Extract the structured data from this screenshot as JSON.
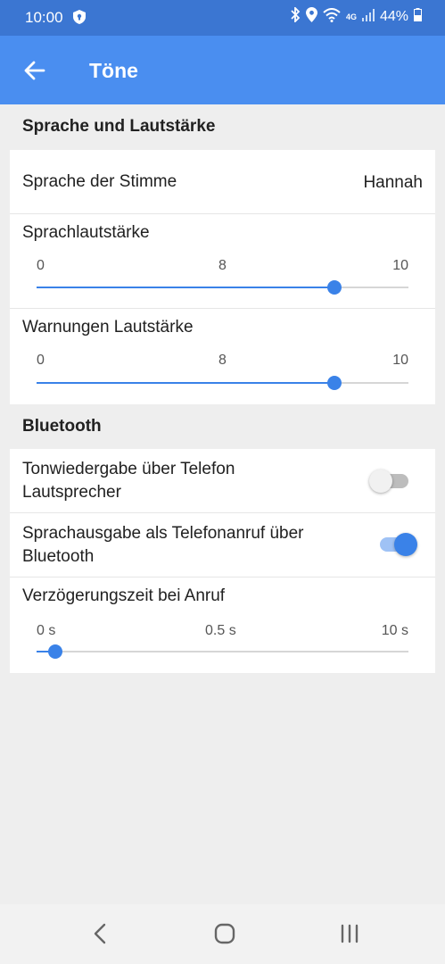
{
  "status": {
    "time": "10:00",
    "battery": "44%",
    "network": "4G",
    "icons": [
      "shield-icon",
      "bluetooth-icon",
      "location-icon",
      "wifi-icon",
      "signal-icon",
      "battery-icon"
    ]
  },
  "appbar": {
    "title": "Töne",
    "back_icon": "arrow-left-icon"
  },
  "colors": {
    "statusbar": "#3b76d2",
    "appbar": "#4a8ef0",
    "accent": "#3a82e8"
  },
  "sections": {
    "speech": {
      "title": "Sprache und Lautstärke",
      "voice": {
        "label": "Sprache der Stimme",
        "value": "Hannah"
      },
      "speech_volume": {
        "label": "Sprachlautstärke",
        "ticks": [
          "0",
          "8",
          "10"
        ],
        "min": 0,
        "max": 10,
        "value": 8
      },
      "warning_volume": {
        "label": "Warnungen Lautstärke",
        "ticks": [
          "0",
          "8",
          "10"
        ],
        "min": 0,
        "max": 10,
        "value": 8
      }
    },
    "bluetooth": {
      "title": "Bluetooth",
      "phone_speaker": {
        "line1": "Tonwiedergabe über Telefon",
        "line2": "Lautsprecher",
        "checked": false
      },
      "call_output": {
        "line1": "Sprachausgabe als Telefonanruf über",
        "line2": "Bluetooth",
        "checked": true
      },
      "call_delay": {
        "label": "Verzögerungszeit bei Anruf",
        "ticks": [
          "0 s",
          "0.5 s",
          "10 s"
        ],
        "value_label": "0.5 s"
      }
    }
  },
  "navbar": {
    "icons": [
      "back-nav-icon",
      "home-nav-icon",
      "recents-nav-icon"
    ]
  }
}
